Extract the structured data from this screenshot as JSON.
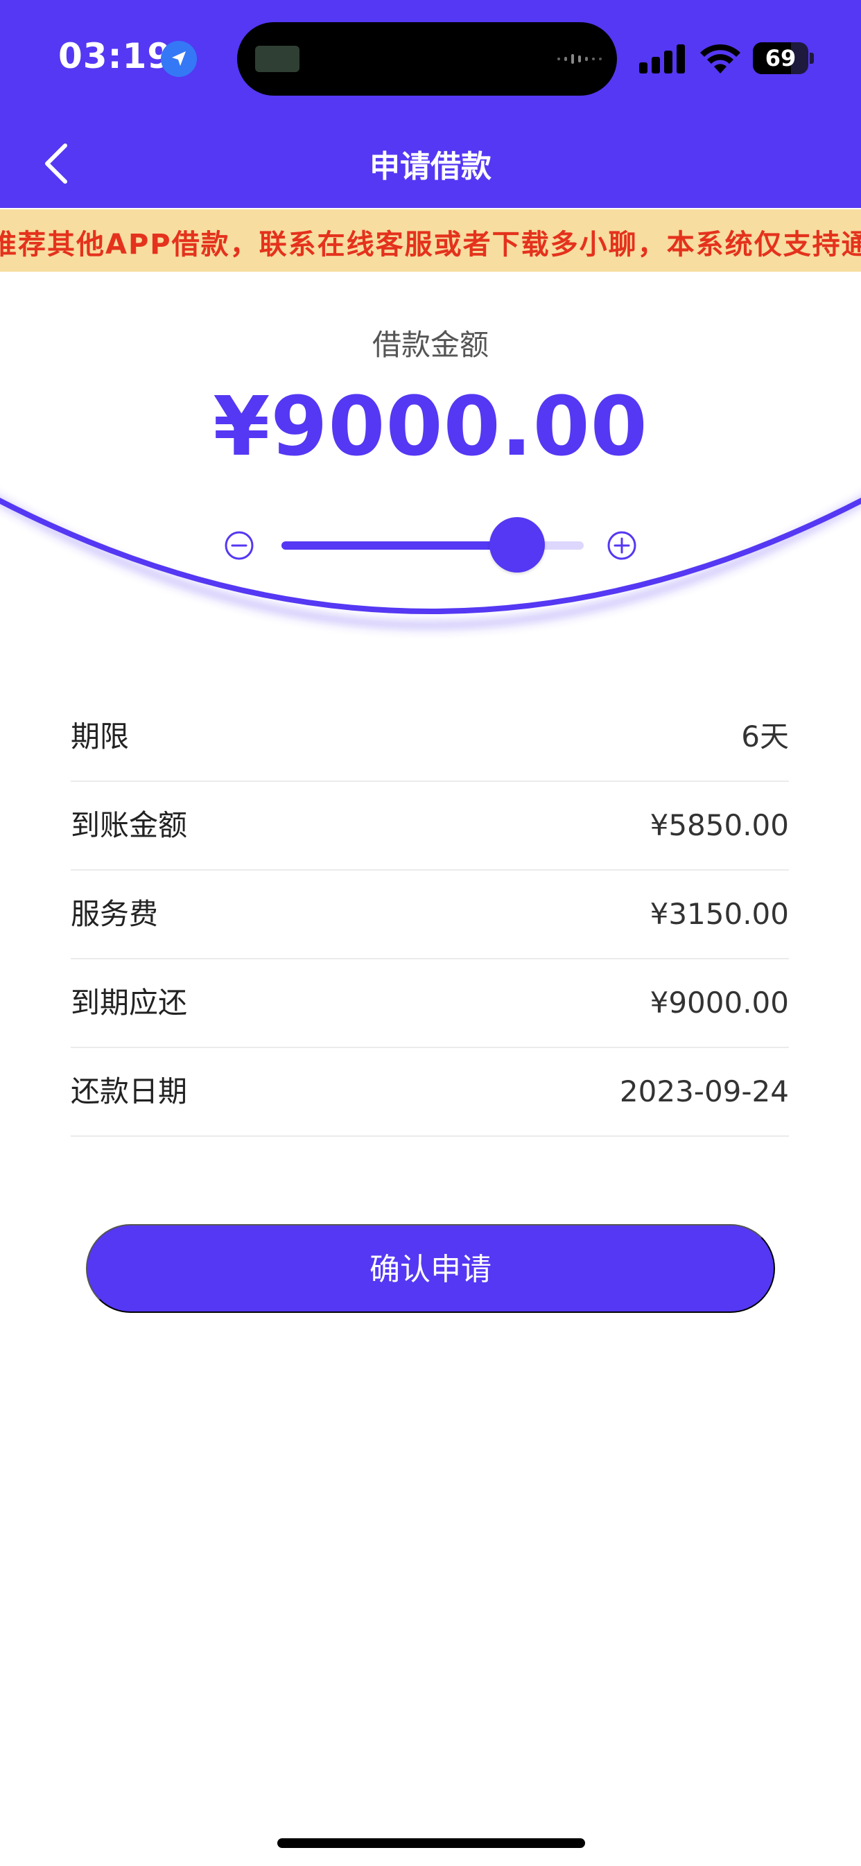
{
  "status_bar": {
    "time": "03:19",
    "battery_level": "69",
    "icons": [
      "location-arrow-icon",
      "cellular-signal-icon",
      "wifi-icon",
      "battery-icon"
    ]
  },
  "nav": {
    "title": "申请借款",
    "back_icon": "chevron-left-icon"
  },
  "notice": {
    "text": "推荐其他APP借款，联系在线客服或者下载多小聊，本系统仅支持通过"
  },
  "loan": {
    "amount_label": "借款金额",
    "amount_value": "¥9000.00",
    "slider_fraction": 0.78,
    "minus_icon": "minus-circle-icon",
    "plus_icon": "plus-circle-icon"
  },
  "details": [
    {
      "label": "期限",
      "value": "6天"
    },
    {
      "label": "到账金额",
      "value": "¥5850.00"
    },
    {
      "label": "服务费",
      "value": "¥3150.00"
    },
    {
      "label": "到期应还",
      "value": "¥9000.00"
    },
    {
      "label": "还款日期",
      "value": "2023-09-24"
    }
  ],
  "actions": {
    "confirm_label": "确认申请"
  },
  "colors": {
    "primary": "#5438f3",
    "notice_bg": "#f7dda0",
    "notice_text": "#e4321d"
  }
}
